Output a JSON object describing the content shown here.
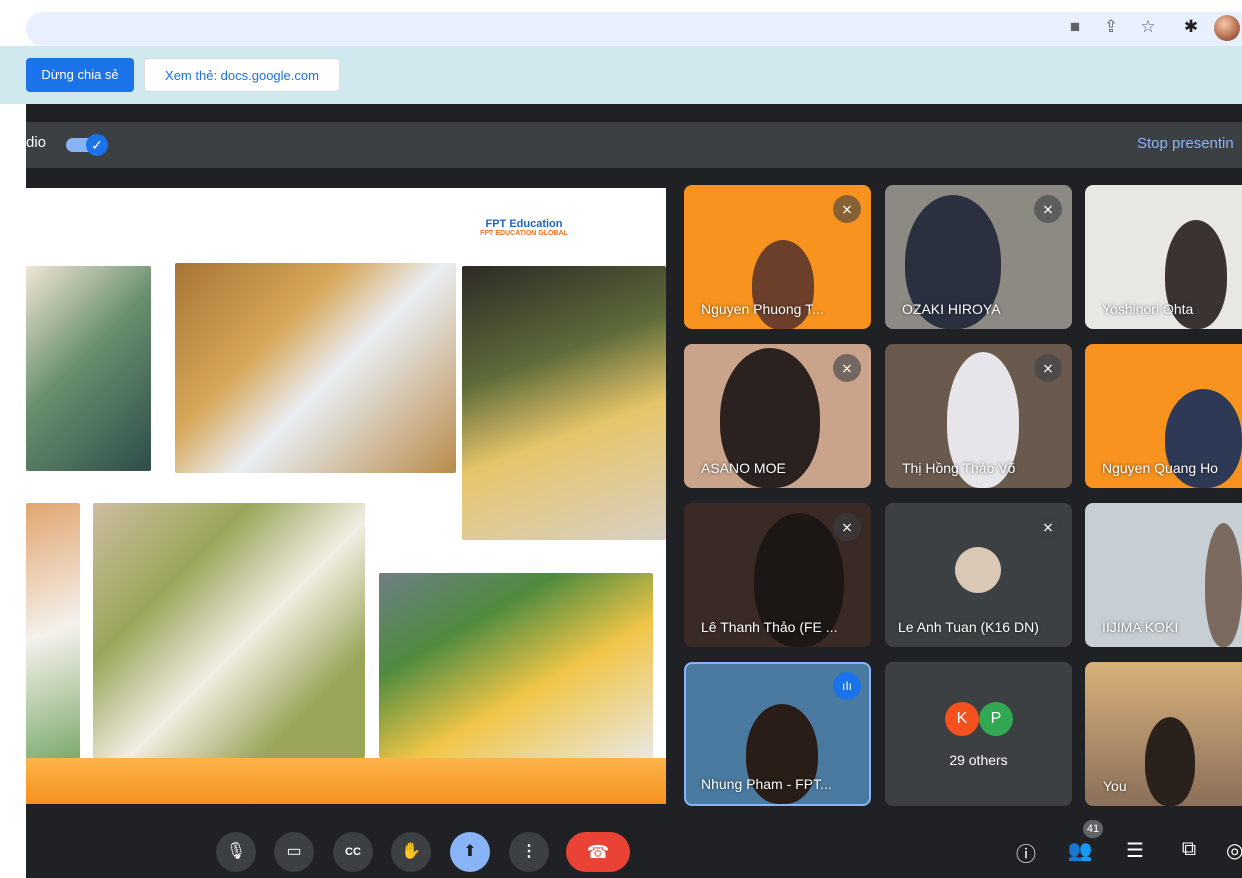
{
  "browser": {
    "icons": [
      "camera-icon",
      "share-icon",
      "star-icon",
      "extensions-icon",
      "profile-avatar"
    ]
  },
  "share_bar": {
    "stop_share_label": "Dừng chia sẻ",
    "view_tab_label": "Xem thẻ: docs.google.com"
  },
  "present_strip": {
    "audio_label": "dio",
    "stop_presenting_label": "Stop presentin"
  },
  "slide": {
    "logo_mark": "FPT Education",
    "logo_text": "FPT EDUCATION GLOBAL"
  },
  "tiles": [
    {
      "name": "Nguyen Phuong T...",
      "muted": true
    },
    {
      "name": "OZAKI HIROYA",
      "muted": true
    },
    {
      "name": "Yoshinori Ohta",
      "muted": true
    },
    {
      "name": "ASANO MOE",
      "muted": true
    },
    {
      "name": "Thị Hồng Thảo Võ",
      "muted": true
    },
    {
      "name": "Nguyen Quang Ho",
      "muted": true
    },
    {
      "name": "Lê Thanh Thảo (FE ...",
      "muted": true
    },
    {
      "name": "Le Anh Tuan (K16 DN)",
      "muted": true
    },
    {
      "name": "IIJIMA KOKI",
      "muted": false
    },
    {
      "name": "Nhung Pham - FPT...",
      "muted": false
    },
    {
      "name": "29 others",
      "avatars": [
        "K",
        "P"
      ]
    },
    {
      "name": "You",
      "muted": false
    }
  ],
  "controls": {
    "participants_count": "41"
  },
  "colors": {
    "accent": "#1a73e8",
    "end_call": "#ea4335",
    "tile_bg": "#3c4043",
    "slide_orange": "#f7931e"
  }
}
